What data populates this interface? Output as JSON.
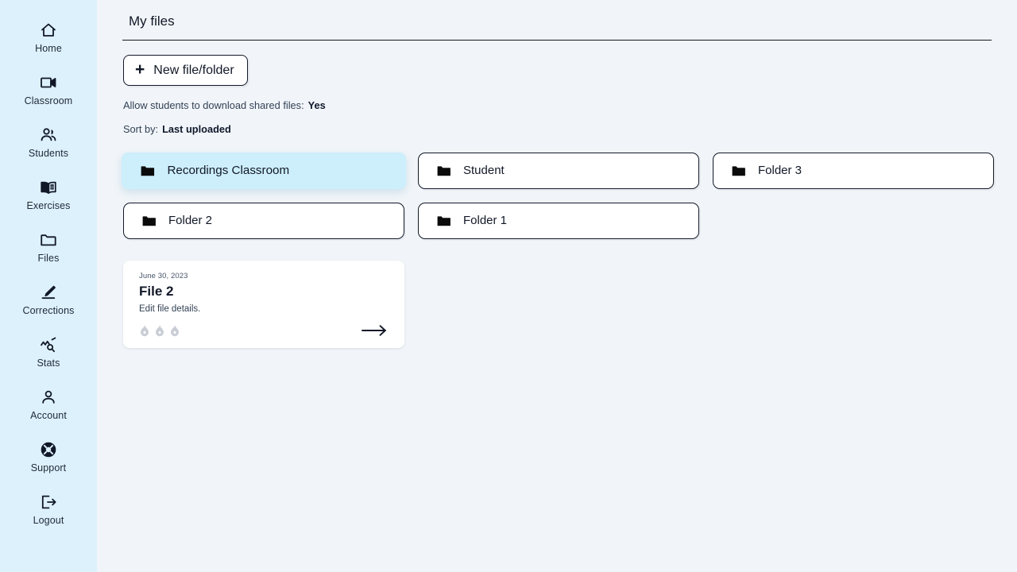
{
  "sidebar": {
    "items": [
      {
        "label": "Home",
        "icon": "home-icon"
      },
      {
        "label": "Classroom",
        "icon": "video-camera-icon"
      },
      {
        "label": "Students",
        "icon": "users-icon"
      },
      {
        "label": "Exercises",
        "icon": "open-book-icon"
      },
      {
        "label": "Files",
        "icon": "folder-outline-icon"
      },
      {
        "label": "Corrections",
        "icon": "pencil-icon"
      },
      {
        "label": "Stats",
        "icon": "chart-search-icon"
      },
      {
        "label": "Account",
        "icon": "person-icon"
      },
      {
        "label": "Support",
        "icon": "lifebuoy-icon"
      },
      {
        "label": "Logout",
        "icon": "logout-arrow-icon"
      }
    ],
    "background_color": "#ddf1fc"
  },
  "header": {
    "title": "My files"
  },
  "toolbar": {
    "new_button_label": "New file/folder",
    "new_button_icon": "plus-icon"
  },
  "settings": {
    "allow_download_label": "Allow students to download shared files:",
    "allow_download_value": "Yes",
    "sort_by_label": "Sort by:",
    "sort_by_value": "Last uploaded"
  },
  "folders": [
    {
      "name": "Recordings Classroom",
      "icon": "folder-icon",
      "active": true
    },
    {
      "name": "Student",
      "icon": "folder-icon",
      "active": false
    },
    {
      "name": "Folder 3",
      "icon": "folder-icon",
      "active": false
    },
    {
      "name": "Folder 2",
      "icon": "folder-icon",
      "active": false
    },
    {
      "name": "Folder 1",
      "icon": "folder-icon",
      "active": false
    }
  ],
  "files": [
    {
      "date": "June 30, 2023",
      "title": "File 2",
      "subtitle": "Edit file details.",
      "flame_count": 3,
      "flame_icon": "flame-icon",
      "arrow_icon": "arrow-right-icon"
    }
  ],
  "colors": {
    "page_background": "#f1f5f9",
    "sidebar": "#ddf1fc",
    "active_card": "#cdeefb",
    "card": "#ffffff",
    "border": "#111827",
    "text": "#111827",
    "muted_text": "#334155",
    "flame": "#c9ced6"
  }
}
